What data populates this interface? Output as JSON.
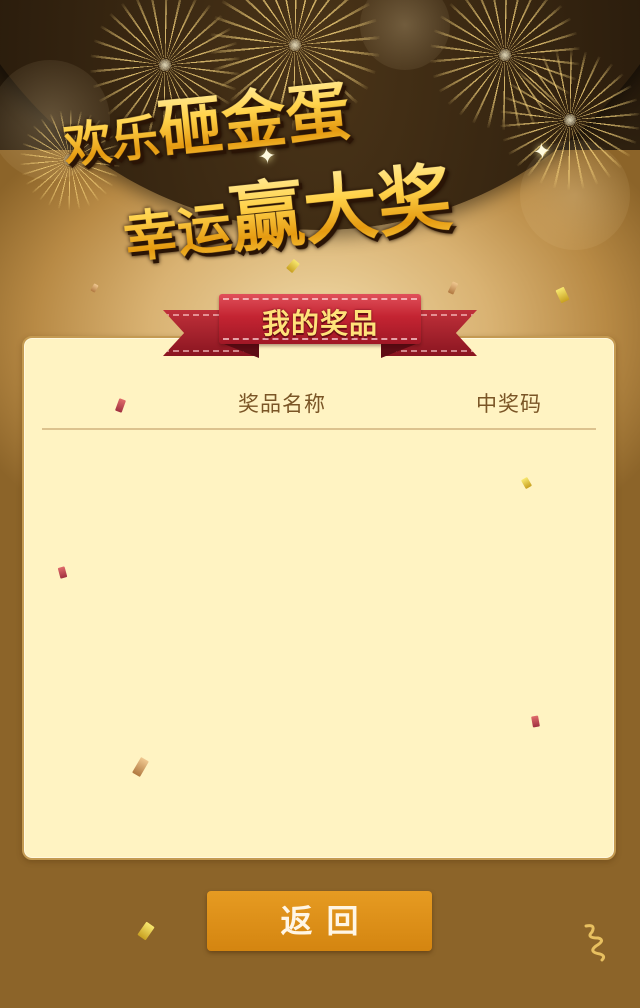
{
  "banner": {
    "title_line1_small": "欢乐",
    "title_line1_big": "砸金蛋",
    "title_line2_small": "幸运",
    "title_line2_big": "赢大奖"
  },
  "prize_panel": {
    "ribbon_title": "我的奖品",
    "columns": [
      "奖品名称",
      "中奖码"
    ],
    "rows": []
  },
  "back_button": {
    "label": "返回"
  },
  "colors": {
    "ribbon_red": "#c42432",
    "button_orange": "#e0921a",
    "panel_bg": "#fff3c2",
    "title_gold": "#ffd34d"
  }
}
